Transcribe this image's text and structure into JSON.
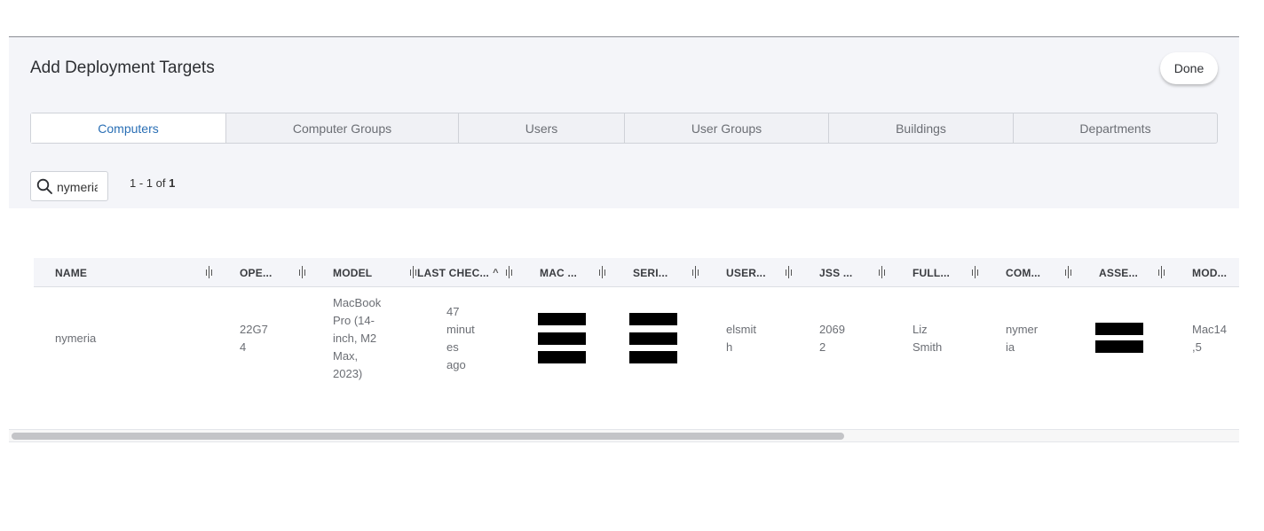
{
  "dialog": {
    "title": "Add Deployment Targets",
    "done_label": "Done"
  },
  "tabs": [
    {
      "label": "Computers",
      "active": true
    },
    {
      "label": "Computer Groups"
    },
    {
      "label": "Users"
    },
    {
      "label": "User Groups"
    },
    {
      "label": "Buildings"
    },
    {
      "label": "Departments"
    }
  ],
  "search": {
    "value": "nymeria"
  },
  "pagination": {
    "range": "1 - 1 of ",
    "total": "1"
  },
  "table": {
    "columns": [
      "NAME",
      "OPE...",
      "MODEL",
      "LAST CHEC...",
      "MAC ...",
      "SERI...",
      "USER...",
      "JSS ...",
      "FULL...",
      "COM...",
      "ASSE...",
      "MOD..."
    ],
    "sorted_column": "LAST CHEC...",
    "sort_direction": "ascending",
    "row": {
      "name": "nymeria",
      "os": [
        "22G7",
        "4"
      ],
      "model": [
        "MacBook",
        "Pro (14-",
        "inch, M2",
        "Max,",
        "2023)"
      ],
      "last_check": [
        "47",
        "minut",
        "es",
        "ago"
      ],
      "username": [
        "elsmit",
        "h"
      ],
      "jss": [
        "2069",
        "2"
      ],
      "full_name": [
        "Liz",
        "Smith"
      ],
      "computer": [
        "nymer",
        "ia"
      ],
      "model_id": [
        "Mac14",
        ",5"
      ]
    }
  }
}
